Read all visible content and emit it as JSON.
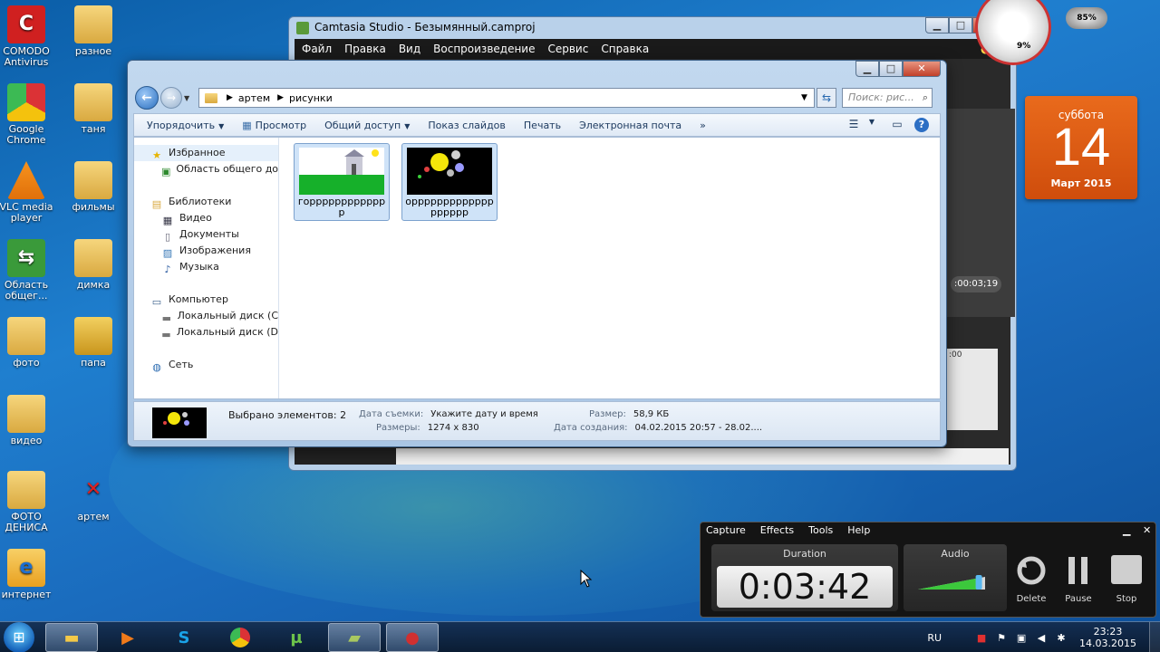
{
  "desktop_icons": [
    {
      "label": "COMODO Antivirus",
      "icon": "comodo-icon"
    },
    {
      "label": "разное",
      "icon": "folder-icon"
    },
    {
      "label": "Google Chrome",
      "icon": "chrome-icon"
    },
    {
      "label": "таня",
      "icon": "folder-icon"
    },
    {
      "label": "VLC media player",
      "icon": "vlc-icon"
    },
    {
      "label": "фильмы",
      "icon": "folder-icon"
    },
    {
      "label": "Область общег...",
      "icon": "share-icon"
    },
    {
      "label": "димка",
      "icon": "folder-icon"
    },
    {
      "label": "фото",
      "icon": "folder-icon"
    },
    {
      "label": "папа",
      "icon": "lock-icon"
    },
    {
      "label": "видео",
      "icon": "folder-icon"
    },
    {
      "label": "ФОТО ДЕНИСА",
      "icon": "folder-icon"
    },
    {
      "label": "артем",
      "icon": "x-icon"
    },
    {
      "label": "интернет",
      "icon": "ie-folder-icon"
    }
  ],
  "camtasia": {
    "title": "Camtasia Studio - Безымянный.camproj",
    "menu": [
      "Файл",
      "Правка",
      "Вид",
      "Воспроизведение",
      "Сервис",
      "Справка"
    ],
    "time": ":00:03;19",
    "timeline_mark": ":00"
  },
  "gadgets": {
    "cpu_value": "9%",
    "mem_value": "85%",
    "calendar": {
      "dow": "суббота",
      "day": "14",
      "month": "Март 2015"
    }
  },
  "explorer": {
    "window_buttons": {
      "min": "▁",
      "max": "□",
      "close": "✕"
    },
    "address": [
      "артем",
      "рисунки"
    ],
    "search_placeholder": "Поиск: рис...",
    "toolbar": [
      "Упорядочить",
      "Просмотр",
      "Общий доступ",
      "Показ слайдов",
      "Печать",
      "Электронная почта",
      "»"
    ],
    "nav": {
      "favorites": "Избранное",
      "favorites_items": [
        "Область общего до"
      ],
      "libraries": "Библиотеки",
      "libraries_items": [
        "Видео",
        "Документы",
        "Изображения",
        "Музыка"
      ],
      "computer": "Компьютер",
      "computer_items": [
        "Локальный диск (C",
        "Локальный диск (D"
      ],
      "network": "Сеть"
    },
    "files": [
      {
        "name": "горрррррррррррр"
      },
      {
        "name": "оррррррррррррррррррр"
      }
    ],
    "details": {
      "selected": "Выбрано элементов: 2",
      "date_taken_label": "Дата съемки:",
      "date_taken_value": "Укажите дату и время",
      "dimensions_label": "Размеры:",
      "dimensions_value": "1274 x 830",
      "size_label": "Размер:",
      "size_value": "58,9 КБ",
      "created_label": "Дата создания:",
      "created_value": "04.02.2015 20:57 - 28.02...."
    }
  },
  "recorder": {
    "menu": [
      "Capture",
      "Effects",
      "Tools",
      "Help"
    ],
    "duration_label": "Duration",
    "duration": "0:03:42",
    "audio_label": "Audio",
    "audio_level": 0.9,
    "buttons": [
      "Delete",
      "Pause",
      "Stop"
    ]
  },
  "taskbar": {
    "lang": "RU",
    "time": "23:23",
    "date": "14.03.2015"
  }
}
